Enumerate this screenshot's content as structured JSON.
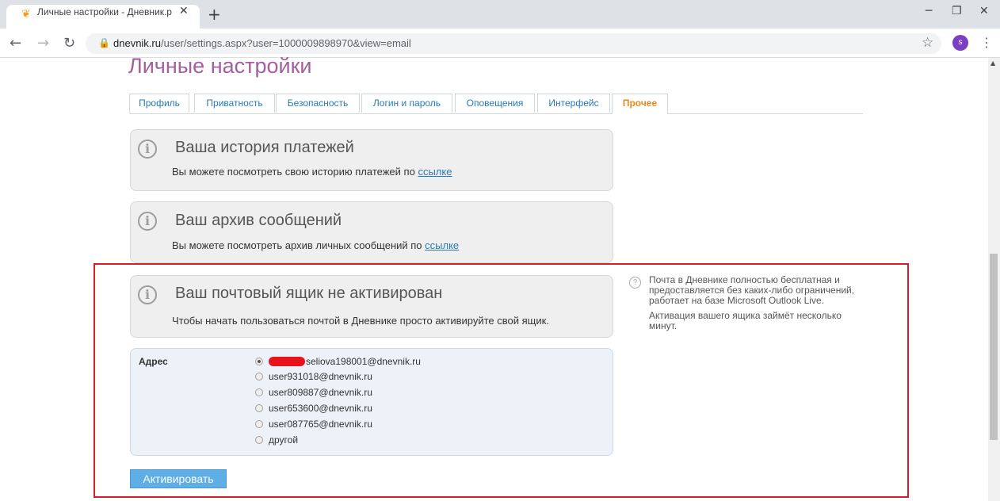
{
  "browser": {
    "tab_title": "Личные настройки - Дневник.р",
    "tab_close": "✕",
    "new_tab": "+",
    "url_host": "dnevnik.ru",
    "url_path": "/user/settings.aspx?user=1000009898970&view=email",
    "avatar_letter": "s",
    "win_minimize": "─",
    "win_restore": "❐",
    "win_close": "✕"
  },
  "page": {
    "title": "Личные настройки",
    "tabs": [
      {
        "label": "Профиль"
      },
      {
        "label": "Приватность"
      },
      {
        "label": "Безопасность"
      },
      {
        "label": "Логин и пароль"
      },
      {
        "label": "Оповещения"
      },
      {
        "label": "Интерфейс"
      },
      {
        "label": "Прочее",
        "active": true
      }
    ]
  },
  "cards": {
    "payments": {
      "title": "Ваша история платежей",
      "text": "Вы можете посмотреть свою историю платежей по",
      "link": "ссылке"
    },
    "archive": {
      "title": "Ваш архив сообщений",
      "text": "Вы можете посмотреть архив личных сообщений по",
      "link": "ссылке"
    },
    "mailbox": {
      "title": "Ваш почтовый ящик не активирован",
      "text": "Чтобы начать пользоваться почтой в Дневнике просто активируйте свой ящик."
    }
  },
  "help": {
    "p1": "Почта в Дневнике полностью бесплатная и предоставляется без каких-либо ограничений, работает на базе Microsoft Outlook Live.",
    "p2": "Активация вашего ящика займёт несколько минут."
  },
  "address": {
    "label": "Адрес",
    "options": [
      {
        "value": "seliova198001@dnevnik.ru",
        "checked": true
      },
      {
        "value": "user931018@dnevnik.ru"
      },
      {
        "value": "user809887@dnevnik.ru"
      },
      {
        "value": "user653600@dnevnik.ru"
      },
      {
        "value": "user087765@dnevnik.ru"
      },
      {
        "value": "другой"
      }
    ]
  },
  "activate_button": "Активировать",
  "colors": {
    "title": "#a35fa0",
    "tab_link": "#2a79b5",
    "tab_active": "#e68a1e",
    "button": "#5faee6",
    "frame": "#d71e2a"
  },
  "icons": [
    "favicon-icon",
    "back-icon",
    "forward-icon",
    "reload-icon",
    "lock-icon",
    "star-icon",
    "menu-icon",
    "info-icon",
    "help-icon"
  ]
}
